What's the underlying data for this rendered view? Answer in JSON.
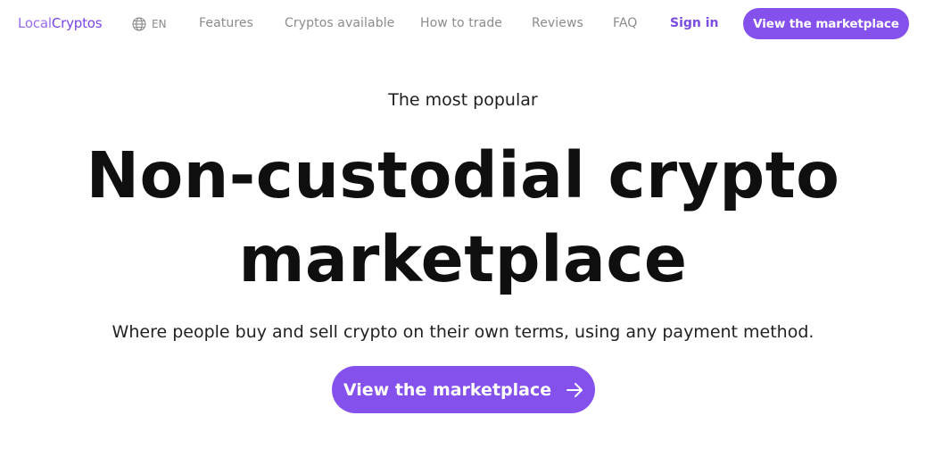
{
  "brand": {
    "name_part1": "Local",
    "name_part2": "Cryptos",
    "primary_color": "#8551ec",
    "logo_color_light": "#9a6bf0",
    "logo_color_dark": "#7a44e6"
  },
  "nav": {
    "language": "EN",
    "language_icon": "globe-icon",
    "links": [
      {
        "label": "Features"
      },
      {
        "label": "Cryptos available"
      },
      {
        "label": "How to trade"
      },
      {
        "label": "Reviews"
      },
      {
        "label": "FAQ"
      }
    ],
    "sign_in": "Sign in",
    "cta": "View the marketplace"
  },
  "hero": {
    "eyebrow": "The most popular",
    "headline_line1": "Non-custodial crypto",
    "headline_line2": "marketplace",
    "subtitle": "Where people buy and sell crypto on their own terms, using any payment method.",
    "cta": "View the marketplace",
    "cta_icon": "arrow-right-icon"
  }
}
